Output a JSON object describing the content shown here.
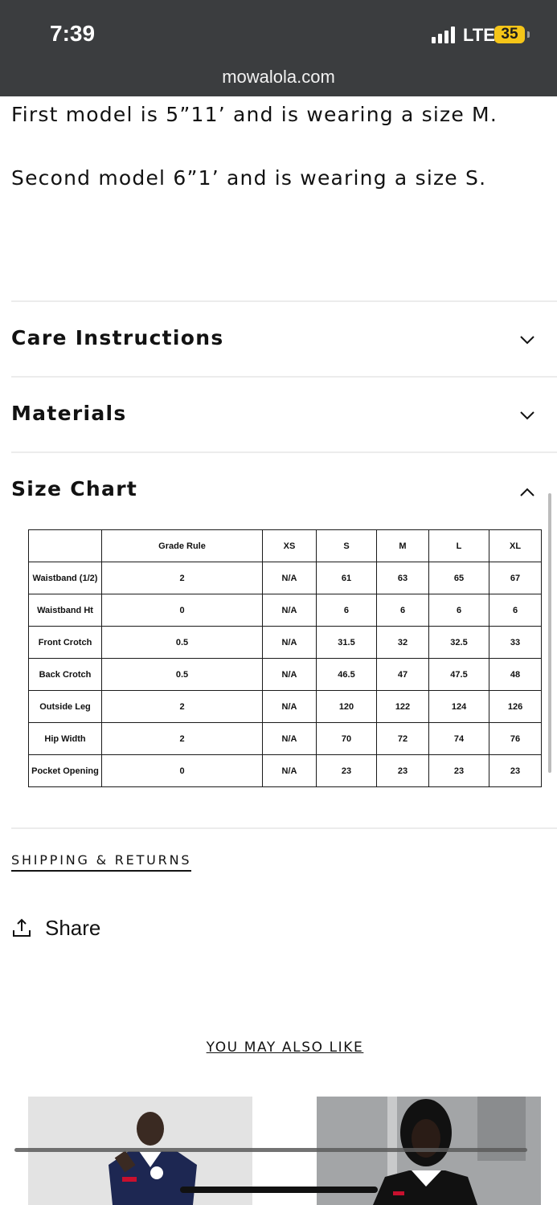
{
  "status_bar": {
    "time": "7:39",
    "network": "LTE",
    "battery": "35",
    "battery_color": "#f5c518"
  },
  "browser": {
    "url": "mowalola.com"
  },
  "model_info": {
    "line1": "First model is 5”11’ and is wearing a size M.",
    "line2": "Second model 6”1’ and is wearing a size S."
  },
  "accordions": [
    {
      "title": "Care Instructions",
      "icon": "chevron-down-icon",
      "expanded": false
    },
    {
      "title": "Materials",
      "icon": "chevron-down-icon",
      "expanded": false
    },
    {
      "title": "Size Chart",
      "icon": "chevron-up-icon",
      "expanded": true
    }
  ],
  "size_chart": {
    "headers": [
      "",
      "Grade Rule",
      "XS",
      "S",
      "M",
      "L",
      "XL"
    ],
    "rows": [
      [
        "Waistband (1/2)",
        "2",
        "N/A",
        "61",
        "63",
        "65",
        "67"
      ],
      [
        "Waistband Ht",
        "0",
        "N/A",
        "6",
        "6",
        "6",
        "6"
      ],
      [
        "Front Crotch",
        "0.5",
        "N/A",
        "31.5",
        "32",
        "32.5",
        "33"
      ],
      [
        "Back Crotch",
        "0.5",
        "N/A",
        "46.5",
        "47",
        "47.5",
        "48"
      ],
      [
        "Outside Leg",
        "2",
        "N/A",
        "120",
        "122",
        "124",
        "126"
      ],
      [
        "Hip Width",
        "2",
        "N/A",
        "70",
        "72",
        "74",
        "76"
      ],
      [
        "Pocket Opening",
        "0",
        "N/A",
        "23",
        "23",
        "23",
        "23"
      ]
    ]
  },
  "links": {
    "shipping_returns": "SHIPPING & RETURNS",
    "share": "Share",
    "share_icon": "share-icon"
  },
  "recommendations": {
    "heading": "YOU MAY ALSO LIKE",
    "products": [
      {
        "image": "product-image-navy-polo"
      },
      {
        "image": "product-image-black-white-polo"
      }
    ]
  }
}
